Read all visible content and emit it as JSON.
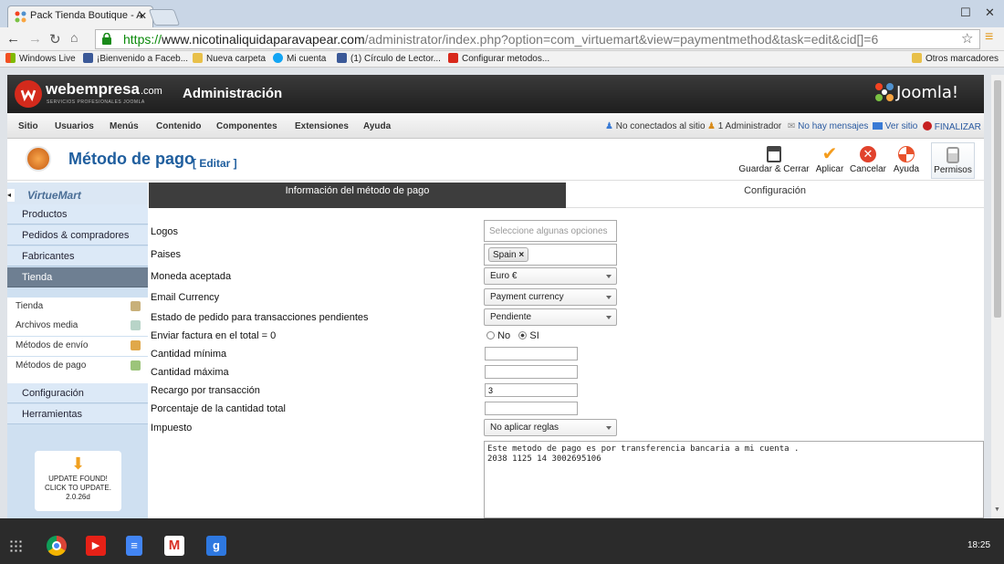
{
  "browser": {
    "tab_title": "Pack Tienda Boutique - A",
    "url_proto": "https://",
    "url_host": "www.nicotinaliquidaparavapear.com",
    "url_path": "/administrator/index.php?option=com_virtuemart&view=paymentmethod&task=edit&cid[]=6",
    "bookmarks": [
      "Windows Live",
      "¡Bienvenido a Faceb...",
      "Nueva carpeta",
      "Mi cuenta",
      "(1) Círculo de Lector...",
      "Configurar metodos...",
      "Otros marcadores"
    ]
  },
  "header": {
    "brand": "webempresa",
    "brand_suffix": ".com",
    "brand_sub": "SERVICIOS PROFESIONALES JOOMLA",
    "title": "Administración",
    "joomla": "Joomla!"
  },
  "menubar": {
    "items": [
      "Sitio",
      "Usuarios",
      "Menús",
      "Contenido",
      "Componentes",
      "Extensiones",
      "Ayuda"
    ],
    "status": [
      "No conectados al sitio",
      "1 Administrador",
      "No hay mensajes",
      "Ver sitio",
      "FINALIZAR"
    ]
  },
  "page": {
    "title": "Método de pago",
    "edit": "[ Editar ]"
  },
  "toolbar": {
    "save_close": "Guardar & Cerrar",
    "apply": "Aplicar",
    "cancel": "Cancelar",
    "help": "Ayuda",
    "permissions": "Permisos"
  },
  "sidebar": {
    "logo": "VirtueMart",
    "sections": [
      "Productos",
      "Pedidos & compradores",
      "Fabricantes",
      "Tienda"
    ],
    "sub": [
      "Tienda",
      "Archivos media",
      "Métodos de envío",
      "Métodos de pago"
    ],
    "sections2": [
      "Configuración",
      "Herramientas"
    ],
    "update": [
      "UPDATE FOUND!",
      "CLICK TO UPDATE.",
      "2.0.26d"
    ]
  },
  "form": {
    "tabs": [
      "Información del método de pago",
      "Configuración"
    ],
    "labels": {
      "logos": "Logos",
      "countries": "Paises",
      "currency": "Moneda aceptada",
      "email_currency": "Email Currency",
      "pending_status": "Estado de pedido para transacciones pendientes",
      "invoice_zero": "Enviar factura en el total = 0",
      "min_amount": "Cantidad mínima",
      "max_amount": "Cantidad máxima",
      "surcharge": "Recargo por transacción",
      "percent": "Porcentaje de la cantidad total",
      "tax": "Impuesto"
    },
    "logos_placeholder": "Seleccione algunas opciones",
    "country_tag": "Spain",
    "currency_value": "Euro €",
    "email_currency_value": "Payment currency",
    "pending_value": "Pendiente",
    "radio_no": "No",
    "radio_si": "SI",
    "surcharge_value": "3",
    "tax_value": "No aplicar reglas",
    "description_line1": "Este metodo de pago es por transferencia bancaria a mi cuenta .",
    "description_line2": "2038 1125 14 3002695106"
  },
  "taskbar": {
    "clock": "18:25"
  },
  "colors": {
    "sidebar_bg": "#cfe0f1",
    "active_section": "#6e7f92",
    "tab_active": "#3d3d3d",
    "joomla_orange": "#f49c1d"
  }
}
